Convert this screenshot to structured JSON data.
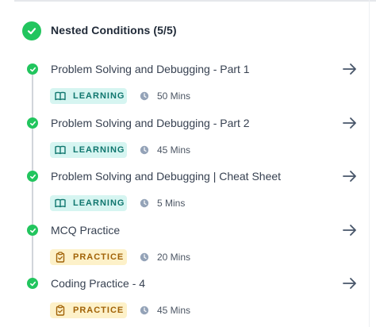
{
  "colors": {
    "success": "#22c55e",
    "learning_bg": "#d6f5f1",
    "learning_text": "#0f766e",
    "practice_bg": "#fdf1c9",
    "practice_text": "#a16207"
  },
  "section": {
    "title": "Nested Conditions (5/5)",
    "icon": "check-circle-icon"
  },
  "items": [
    {
      "title": "Problem Solving and Debugging - Part 1",
      "badge": "LEARNING",
      "badge_icon": "book-icon",
      "duration": "50 Mins"
    },
    {
      "title": "Problem Solving and Debugging - Part 2",
      "badge": "LEARNING",
      "badge_icon": "book-icon",
      "duration": "45 Mins"
    },
    {
      "title": "Problem Solving and Debugging | Cheat Sheet",
      "badge": "LEARNING",
      "badge_icon": "book-icon",
      "duration": "5 Mins"
    },
    {
      "title": "MCQ Practice",
      "badge": "PRACTICE",
      "badge_icon": "clipboard-icon",
      "duration": "20 Mins"
    },
    {
      "title": "Coding Practice - 4",
      "badge": "PRACTICE",
      "badge_icon": "clipboard-icon",
      "duration": "45 Mins"
    }
  ]
}
